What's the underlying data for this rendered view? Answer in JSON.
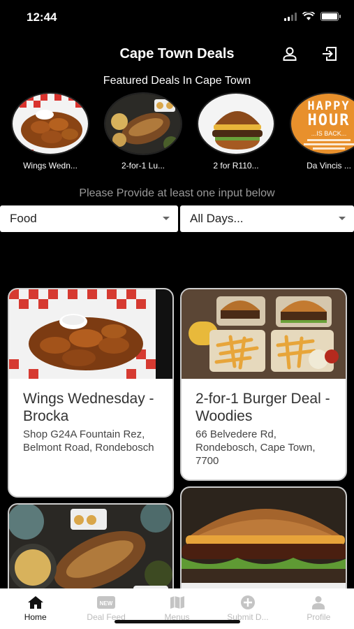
{
  "status": {
    "time": "12:44"
  },
  "header": {
    "title": "Cape Town Deals",
    "account_icon": "account-icon",
    "logout_icon": "logout-icon"
  },
  "featured": {
    "title": "Featured Deals In Cape Town",
    "items": [
      {
        "label": "Wings Wedn..."
      },
      {
        "label": "2-for-1 Lu..."
      },
      {
        "label": "2 for R110..."
      },
      {
        "label": "Da Vincis ...",
        "badge_lines": [
          "HAPPY",
          "HOUR",
          "...IS BACK..."
        ]
      }
    ]
  },
  "filters": {
    "prompt": "Please Provide at least one input below",
    "category": "Food",
    "day": "All Days..."
  },
  "deals": [
    {
      "name": "Wings Wednesday - Brocka",
      "address": "Shop G24A Fountain Rez, Belmont Road, Rondebosch"
    },
    {
      "name": "2-for-1 Burger Deal - Woodies",
      "address": "66 Belvedere Rd, Rondebosch, Cape Town, 7700"
    }
  ],
  "tabs": [
    {
      "label": "Home",
      "icon": "home-icon",
      "active": true
    },
    {
      "label": "Deal Feed",
      "icon": "new-badge-icon"
    },
    {
      "label": "Menus",
      "icon": "map-icon"
    },
    {
      "label": "Submit D...",
      "icon": "plus-circle-icon"
    },
    {
      "label": "Profile",
      "icon": "person-icon"
    }
  ],
  "colors": {
    "background": "#000000",
    "card": "#ffffff",
    "happy_hour": "#e8902c",
    "tab_active": "#111111",
    "tab_inactive": "#bbbbbb"
  }
}
